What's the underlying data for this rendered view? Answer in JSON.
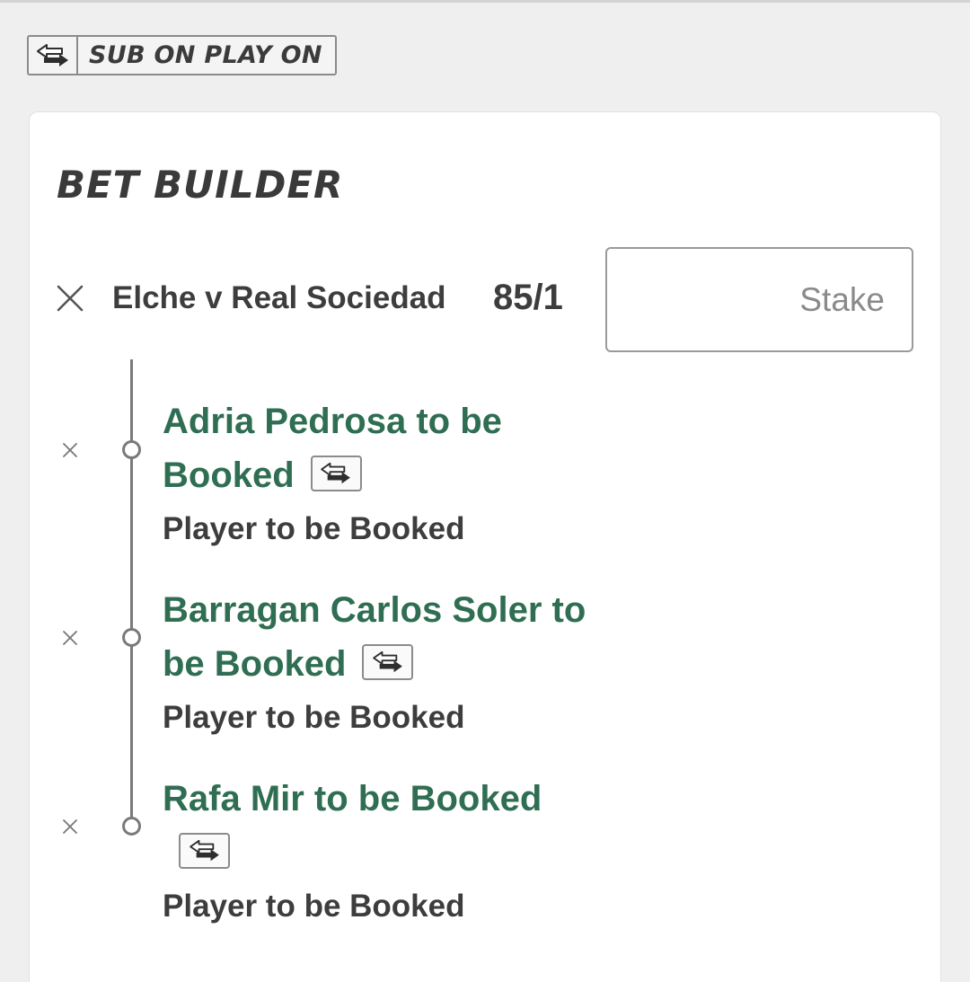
{
  "badge": {
    "label": "SUB ON PLAY ON",
    "icon": "sub-arrows-icon"
  },
  "card": {
    "title": "BET BUILDER",
    "match": "Elche v Real Sociedad",
    "odds": "85/1",
    "stake_placeholder": "Stake",
    "stake_value": ""
  },
  "selections": [
    {
      "name_line1": "Adria Pedrosa to be",
      "name_line2": "Booked",
      "market": "Player to be Booked"
    },
    {
      "name_line1": "Barragan Carlos Soler to",
      "name_line2": "be Booked",
      "market": "Player to be Booked"
    },
    {
      "name_line1": "Rafa Mir to be Booked",
      "name_line2": "",
      "market": "Player to be Booked"
    }
  ],
  "colors": {
    "selection_green": "#2f6e52",
    "text_dark": "#3d3d3d",
    "page_bg": "#efefef",
    "card_bg": "#ffffff"
  }
}
